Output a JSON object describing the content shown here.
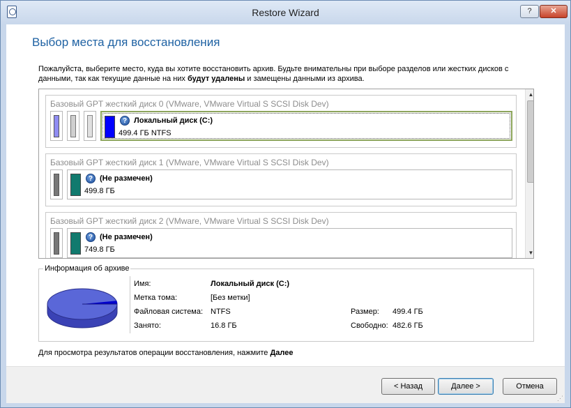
{
  "window": {
    "title": "Restore Wizard",
    "help_label": "?",
    "close_label": "✕"
  },
  "page": {
    "title": "Выбор места для восстановления",
    "instruction_part1": "Пожалуйста, выберите место, куда вы хотите восстановить архив. Будьте внимательны при выборе разделов или жестких дисков с данными, так как текущие данные на них ",
    "instruction_bold": "будут удалены",
    "instruction_part2": " и замещены данными из архива."
  },
  "disks": [
    {
      "header": "Базовый GPT жесткий диск 0 (VMware, VMware Virtual S SCSI Disk Dev)",
      "volume_name": "Локальный диск (C:)",
      "volume_size": "499.4 ГБ NTFS"
    },
    {
      "header": "Базовый GPT жесткий диск 1 (VMware, VMware Virtual S SCSI Disk Dev)",
      "volume_name": "(Не размечен)",
      "volume_size": "499.8 ГБ"
    },
    {
      "header": "Базовый GPT жесткий диск 2 (VMware, VMware Virtual S SCSI Disk Dev)",
      "volume_name": "(Не размечен)",
      "volume_size": "749.8 ГБ"
    }
  ],
  "archive_info": {
    "legend": "Информация об архиве",
    "name_label": "Имя:",
    "name_value": "Локальный диск (C:)",
    "volume_label_label": "Метка тома:",
    "volume_label_value": "[Без метки]",
    "fs_label": "Файловая система:",
    "fs_value": "NTFS",
    "used_label": "Занято:",
    "used_value": "16.8 ГБ",
    "size_label": "Размер:",
    "size_value": "499.4 ГБ",
    "free_label": "Свободно:",
    "free_value": "482.6 ГБ",
    "used_fraction": 0.034
  },
  "footer": {
    "text": "Для просмотра результатов операции восстановления, нажмите ",
    "bold": "Далее"
  },
  "buttons": {
    "back": "< Назад",
    "next": "Далее >",
    "cancel": "Отмена"
  },
  "colors": {
    "title_blue": "#1f62a3",
    "ntfs_blue": "#0000ff",
    "unallocated_teal": "#117a6e",
    "pie": "#5a67d8"
  }
}
